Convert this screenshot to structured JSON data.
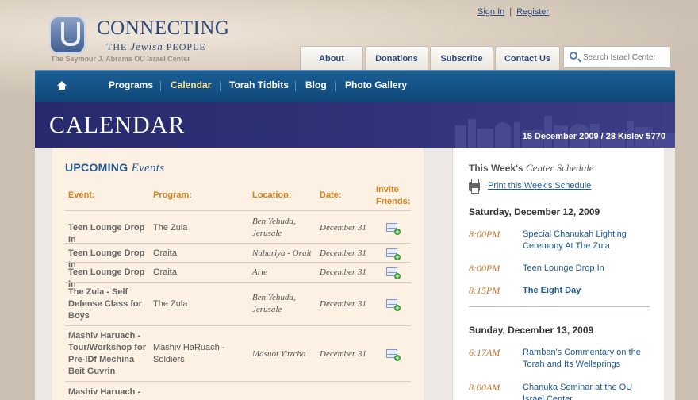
{
  "header": {
    "logo_title": "CONNECTING",
    "logo_sub_pre": "THE",
    "logo_sub_em": "Jewish",
    "logo_sub_post": "PEOPLE",
    "logo_tagline": "The Seymour J. Abrams OU Israel Center",
    "sign_in": "Sign In",
    "separator": "|",
    "register": "Register"
  },
  "tabs": [
    "About",
    "Donations",
    "Subscribe",
    "Contact Us"
  ],
  "search": {
    "placeholder": "Search Israel Center"
  },
  "nav": {
    "items": [
      "Programs",
      "Calendar",
      "Torah Tidbits",
      "Blog",
      "Photo Gallery"
    ],
    "active": "Calendar"
  },
  "banner": {
    "title": "CALENDAR",
    "date": "15 December 2009 / 28 Kislev 5770"
  },
  "upcoming": {
    "title_strong": "UPCOMING",
    "title_em": "Events",
    "headers": [
      "Event:",
      "Program:",
      "Location:",
      "Date:",
      "Invite",
      "Friends:"
    ],
    "rows": [
      {
        "event": "Teen Lounge Drop In",
        "program": "The Zula",
        "location": "Ben Yehuda, Jerusale",
        "date": "December 31"
      },
      {
        "event": "Teen Lounge Drop In",
        "program": "Oraita",
        "location": "Nahariya - Orait",
        "date": "December 31"
      },
      {
        "event": "Teen Lounge Drop In",
        "program": "Oraita",
        "location": "Arie",
        "date": "December 31"
      },
      {
        "event": "The Zula - Self Defense Class for Boys",
        "program": "The Zula",
        "location": "Ben Yehuda, Jerusale",
        "date": "December 31"
      },
      {
        "event": "Mashiv Haruach - Tour/Workshop for Pre-IDf Mechina Beit Guvrin",
        "program": "Mashiv HaRuach - Soldiers",
        "location": "Masuot Yitzcha",
        "date": "December 31"
      },
      {
        "event": "Mashiv Haruach -",
        "program": "",
        "location": "",
        "date": ""
      }
    ]
  },
  "schedule": {
    "title_strong": "This Week's",
    "title_em": "Center Schedule",
    "print_link": "Print this Week's Schedule",
    "days": [
      {
        "day": "Saturday, December 12, 2009",
        "events": [
          {
            "time": "8:00PM",
            "title": "Special Chanukah Lighting Ceremony At The Zula"
          },
          {
            "time": "8:00PM",
            "title": "Teen Lounge Drop In"
          },
          {
            "time": "8:15PM",
            "title": "The Eight Day"
          }
        ]
      },
      {
        "day": "Sunday, December 13, 2009",
        "events": [
          {
            "time": "6:17AM",
            "title": "Ramban's Commentary on the Torah and Its Wellsprings"
          },
          {
            "time": "8:00AM",
            "title": "Chanuka Seminar at the OU Israel Center"
          }
        ]
      }
    ]
  }
}
